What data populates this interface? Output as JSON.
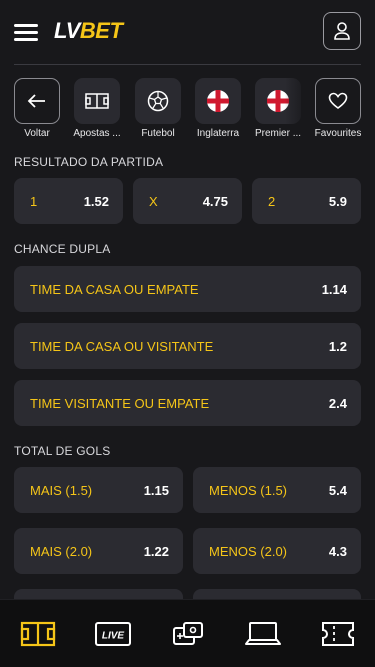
{
  "header": {
    "logo_lv": "LV",
    "logo_bet": "BET"
  },
  "categories": [
    {
      "label": "Voltar",
      "icon": "arrow-left-icon"
    },
    {
      "label": "Apostas ...",
      "icon": "pitch-icon"
    },
    {
      "label": "Futebol",
      "icon": "soccer-ball-icon"
    },
    {
      "label": "Inglaterra",
      "icon": "england-flag-icon"
    },
    {
      "label": "Premier ...",
      "icon": "england-flag-icon"
    },
    {
      "label": "Favourites",
      "icon": "heart-icon"
    }
  ],
  "sections": {
    "resultado": {
      "title": "RESULTADO DA PARTIDA",
      "odds": [
        {
          "name": "1",
          "value": "1.52"
        },
        {
          "name": "X",
          "value": "4.75"
        },
        {
          "name": "2",
          "value": "5.9"
        }
      ]
    },
    "chance_dupla": {
      "title": "CHANCE DUPLA",
      "odds": [
        {
          "name": "TIME DA CASA OU EMPATE",
          "value": "1.14"
        },
        {
          "name": "TIME DA CASA OU VISITANTE",
          "value": "1.2"
        },
        {
          "name": "TIME VISITANTE OU EMPATE",
          "value": "2.4"
        }
      ]
    },
    "total_gols": {
      "title": "TOTAL DE GOLS",
      "odds": [
        {
          "name": "MAIS (1.5)",
          "value": "1.15"
        },
        {
          "name": "MENOS (1.5)",
          "value": "5.4"
        },
        {
          "name": "MAIS (2.0)",
          "value": "1.22"
        },
        {
          "name": "MENOS (2.0)",
          "value": "4.3"
        }
      ]
    }
  },
  "bottom_nav": [
    {
      "icon": "sports-pitch-icon",
      "active": true
    },
    {
      "icon": "live-icon",
      "label": "LIVE"
    },
    {
      "icon": "casino-chip-icon"
    },
    {
      "icon": "laptop-icon"
    },
    {
      "icon": "betslip-ticket-icon"
    }
  ],
  "colors": {
    "accent": "#f5c518",
    "background": "#18181b",
    "card": "#2b2b31"
  }
}
